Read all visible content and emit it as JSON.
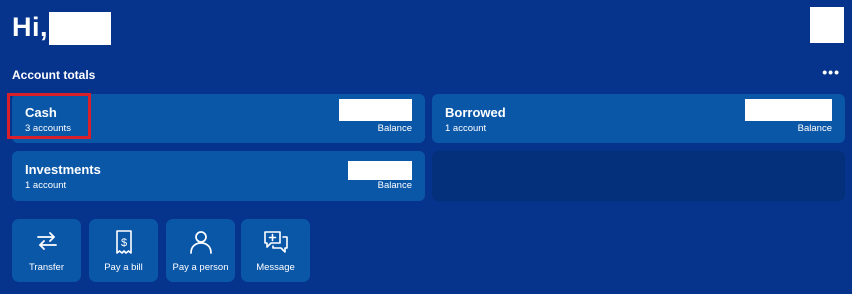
{
  "greeting": "Hi,",
  "account_totals": {
    "title": "Account totals",
    "more": "•••",
    "cards": [
      {
        "name": "Cash",
        "count": "3 accounts",
        "balance_label": "Balance"
      },
      {
        "name": "Borrowed",
        "count": "1 account",
        "balance_label": "Balance"
      },
      {
        "name": "Investments",
        "count": "1 account",
        "balance_label": "Balance"
      }
    ]
  },
  "actions": [
    {
      "label": "Transfer",
      "icon": "transfer-arrows-icon"
    },
    {
      "label": "Pay a bill",
      "icon": "bill-receipt-icon"
    },
    {
      "label": "Pay a person",
      "icon": "person-icon"
    },
    {
      "label": "Message",
      "icon": "message-plus-icon"
    }
  ],
  "colors": {
    "background": "#06348c",
    "card": "#0a57a8",
    "card_empty": "#042f7a",
    "highlight": "#d81f2a"
  }
}
